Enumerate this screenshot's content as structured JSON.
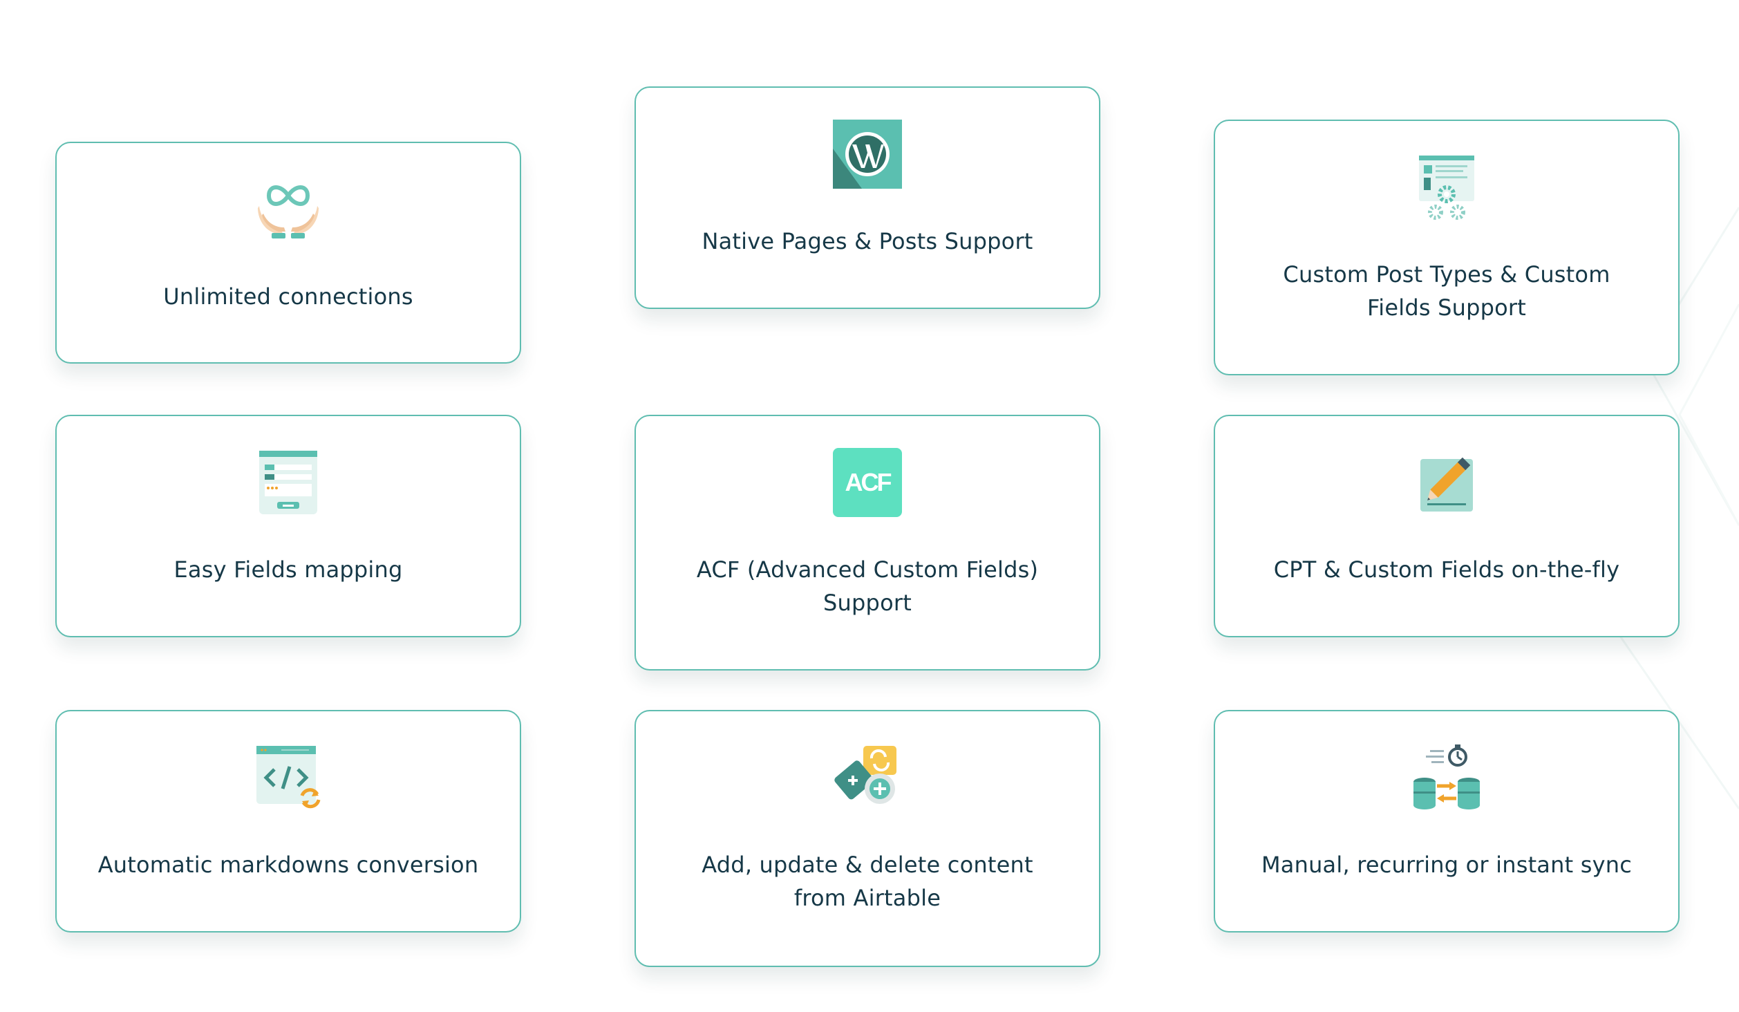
{
  "features": [
    {
      "id": "c1",
      "label": "Unlimited connections",
      "icon": "infinity-hands-icon"
    },
    {
      "id": "c2",
      "label": "Native Pages & Posts Support",
      "icon": "wordpress-icon"
    },
    {
      "id": "c3",
      "label": "Custom Post Types & Custom Fields Support",
      "icon": "post-settings-gears-icon"
    },
    {
      "id": "c4",
      "label": "Easy Fields mapping",
      "icon": "form-fields-icon"
    },
    {
      "id": "c5",
      "label": "ACF (Advanced Custom Fields) Support",
      "icon": "acf-logo-icon",
      "icon_text": "ACF"
    },
    {
      "id": "c6",
      "label": "CPT & Custom Fields on-the-fly",
      "icon": "edit-pencil-icon"
    },
    {
      "id": "c7",
      "label": "Automatic markdowns conversion",
      "icon": "code-convert-icon"
    },
    {
      "id": "c8",
      "label": "Add, update & delete content from Airtable",
      "icon": "airtable-content-icon"
    },
    {
      "id": "c9",
      "label": "Manual, recurring or instant sync",
      "icon": "database-sync-icon"
    }
  ],
  "colors": {
    "border": "#5fbdb0",
    "text": "#163847",
    "teal": "#5bbfb0",
    "teal_dark": "#3f8f86",
    "mint": "#5de0c0",
    "orange": "#f0a32b",
    "background": "#ffffff"
  }
}
